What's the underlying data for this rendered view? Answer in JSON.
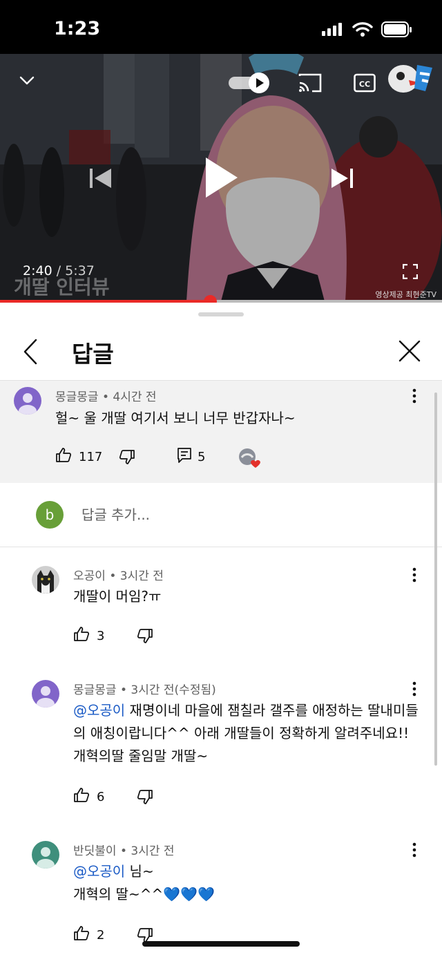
{
  "status_bar": {
    "time": "1:23"
  },
  "video": {
    "current_time": "2:40",
    "separator": " / ",
    "duration": "5:37",
    "progress": 0.475,
    "watermark_title": "개딸 인터뷰",
    "watermark_credit": "영상제공 최현준TV",
    "colors": {
      "progress": "#ea2a27"
    }
  },
  "sheet": {
    "title": "답글",
    "parent_comment": {
      "author": "몽글몽글",
      "age": "4시간 전",
      "text": "헐~ 울 개딸 여기서 보니 너무 반갑자나~",
      "likes": "117",
      "replies": "5"
    },
    "add_reply": {
      "avatar_letter": "b",
      "placeholder": "답글 추가..."
    },
    "replies": [
      {
        "author": "오공이",
        "age": "3시간 전",
        "mention": "",
        "text": "개딸이 머임?ㅠ",
        "likes": "3"
      },
      {
        "author": "몽글몽글",
        "age": "3시간 전(수정됨)",
        "mention": "@오공이",
        "text": "  재명이네 마을에 잼칠라 갤주를  애정하는 딸내미들의 애칭이랍니다^^ 아래 개딸들이 정확하게 알려주네요!!  개혁의딸 줄임말 개딸~",
        "likes": "6"
      },
      {
        "author": "반딧불이",
        "age": "3시간 전",
        "mention": "@오공이",
        "text_after_mention": " 님~",
        "text": "개혁의 딸~^^💙💙💙",
        "likes": "2"
      }
    ]
  }
}
